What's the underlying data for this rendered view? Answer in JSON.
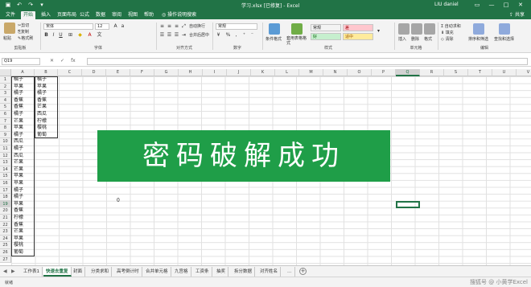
{
  "window": {
    "title": "学习.xlsx [已修复] - Excel",
    "user": "LIU daniel",
    "qat_icons": [
      "save-icon",
      "undo-icon",
      "redo-icon",
      "customize-icon"
    ]
  },
  "menu": {
    "tabs": [
      "文件",
      "开始",
      "插入",
      "页面布局",
      "公式",
      "数据",
      "审阅",
      "视图",
      "帮助"
    ],
    "active_index": 1,
    "tell_me": "操作说明搜索",
    "share": "共享"
  },
  "ribbon": {
    "clipboard": {
      "paste": "粘贴",
      "cut": "剪切",
      "copy": "复制",
      "format_painter": "格式刷",
      "label": "剪贴板"
    },
    "font": {
      "name": "宋体",
      "size": "12",
      "label": "字体"
    },
    "alignment": {
      "wrap": "自动换行",
      "merge": "合并后居中",
      "label": "对齐方式"
    },
    "number": {
      "format": "常规",
      "label": "数字"
    },
    "styles": {
      "conditional": "条件格式",
      "table": "套用表格格式",
      "cells": [
        {
          "text": "常规",
          "bg": "#ffffff",
          "fg": "#222222"
        },
        {
          "text": "差",
          "bg": "#ffc7ce",
          "fg": "#9c0006"
        },
        {
          "text": "好",
          "bg": "#c6efce",
          "fg": "#006100"
        },
        {
          "text": "适中",
          "bg": "#ffeb9c",
          "fg": "#9c5700"
        }
      ],
      "label": "样式"
    },
    "cells_group": {
      "insert": "插入",
      "delete": "删除",
      "format": "格式",
      "label": "单元格"
    },
    "editing": {
      "autosum": "自动求和",
      "fill": "填充",
      "clear": "清除",
      "sort": "排序和筛选",
      "find": "查找和选择",
      "label": "编辑"
    }
  },
  "formula_bar": {
    "name_box": "Q19",
    "fx": "fx",
    "content": ""
  },
  "grid": {
    "columns": [
      "A",
      "B",
      "C",
      "D",
      "E",
      "F",
      "G",
      "H",
      "I",
      "J",
      "K",
      "L",
      "M",
      "N",
      "O",
      "P",
      "Q",
      "R",
      "S",
      "T",
      "U",
      "V"
    ],
    "selected_column": "Q",
    "rows": [
      "1",
      "2",
      "3",
      "4",
      "5",
      "6",
      "7",
      "8",
      "9",
      "10",
      "11",
      "12",
      "13",
      "14",
      "15",
      "16",
      "17",
      "18",
      "19",
      "20",
      "21",
      "22",
      "23",
      "24",
      "25",
      "26",
      "27"
    ],
    "selected_row": "19",
    "col_a": [
      "橘子",
      "苹果",
      "橘子",
      "香蕉",
      "香蕉",
      "橘子",
      "芒果",
      "苹果",
      "橘子",
      "西瓜",
      "橘子",
      "西瓜",
      "芒果",
      "芒果",
      "苹果",
      "苹果",
      "橘子",
      "橘子",
      "苹果",
      "香蕉",
      "柠檬",
      "香蕉",
      "芒果",
      "苹果",
      "樱桃",
      "葡萄",
      ""
    ],
    "col_b": [
      "橘子",
      "苹果",
      "橘子",
      "香蕉",
      "芒果",
      "西瓜",
      "柠檬",
      "樱桃",
      "葡萄"
    ],
    "e19_value": "0"
  },
  "banner": {
    "text": "密码破解成功"
  },
  "sheets": {
    "tabs": [
      "工作表1",
      "快速去重复",
      "封面",
      "分类求和",
      "高考倒计时",
      "合并单元格",
      "九宫格",
      "工资条",
      "抽奖",
      "拆分数据",
      "对齐姓名",
      "…"
    ],
    "active_index": 1
  },
  "status": {
    "text": "就绪"
  },
  "watermark": "搜狐号 @ 小黄学Excel"
}
